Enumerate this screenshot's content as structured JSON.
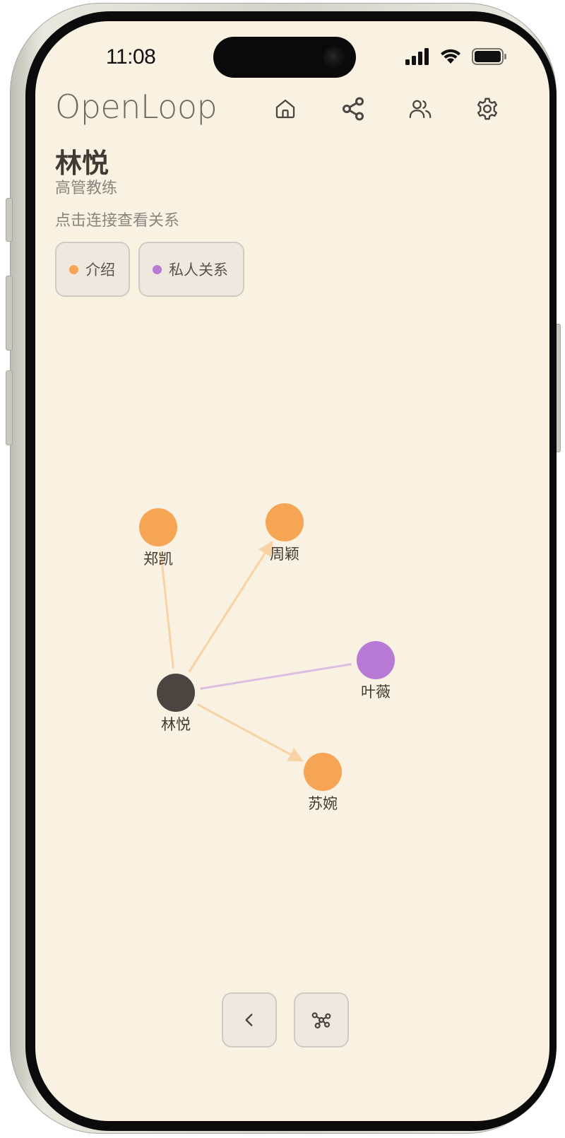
{
  "status_bar": {
    "time": "11:08"
  },
  "header": {
    "brand": "OpenLoop",
    "nav": [
      {
        "name": "home-icon"
      },
      {
        "name": "share-icon"
      },
      {
        "name": "users-icon"
      },
      {
        "name": "gear-icon"
      }
    ]
  },
  "profile": {
    "name": "林悦",
    "role": "高管教练",
    "hint": "点击连接查看关系"
  },
  "legend": [
    {
      "label": "介绍",
      "color": "#f5a553"
    },
    {
      "label": "私人关系",
      "color": "#b87ad4"
    }
  ],
  "graph": {
    "center": {
      "label": "林悦",
      "color": "#4a4540"
    },
    "nodes": [
      {
        "id": "zhengkai",
        "label": "郑凯",
        "type": "介绍",
        "color": "#f5a553"
      },
      {
        "id": "zhouying",
        "label": "周颖",
        "type": "介绍",
        "color": "#f5a553"
      },
      {
        "id": "yewei",
        "label": "叶薇",
        "type": "私人关系",
        "color": "#b87ad4"
      },
      {
        "id": "suwan",
        "label": "苏婉",
        "type": "介绍",
        "color": "#f5a553"
      }
    ],
    "edge_colors": {
      "介绍": "#f8d2a4",
      "私人关系": "#dcbfe0"
    }
  },
  "bottom": {
    "back_icon": "chevron-left-icon",
    "graph_icon": "network-icon"
  }
}
